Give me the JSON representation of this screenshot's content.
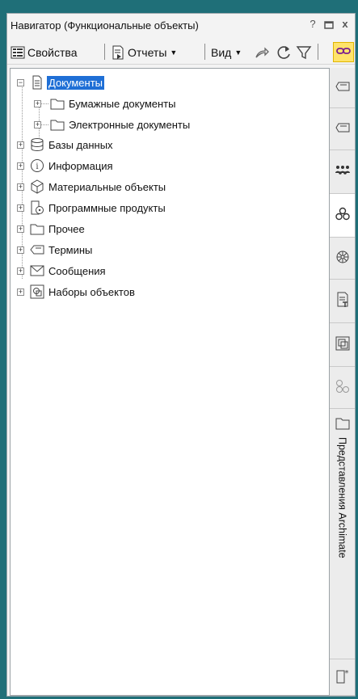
{
  "window": {
    "title": "Навигатор (Функциональные объекты)",
    "help": "?",
    "close": "x"
  },
  "toolbar": {
    "properties_label": "Свойства",
    "reports_label": "Отчеты",
    "view_label": "Вид"
  },
  "tree": {
    "items": [
      {
        "label": "Документы"
      },
      {
        "label": "Бумажные документы"
      },
      {
        "label": "Электронные документы"
      },
      {
        "label": "Базы данных"
      },
      {
        "label": "Информация"
      },
      {
        "label": "Материальные объекты"
      },
      {
        "label": "Программные продукты"
      },
      {
        "label": "Прочее"
      },
      {
        "label": "Термины"
      },
      {
        "label": "Сообщения"
      },
      {
        "label": "Наборы объектов"
      }
    ]
  },
  "sidebar": {
    "vertical_tab_label": "Представления Archimate"
  },
  "colors": {
    "background": "#1f6f78",
    "selection": "#1f6fd6",
    "link_button": "#ffe36a"
  }
}
